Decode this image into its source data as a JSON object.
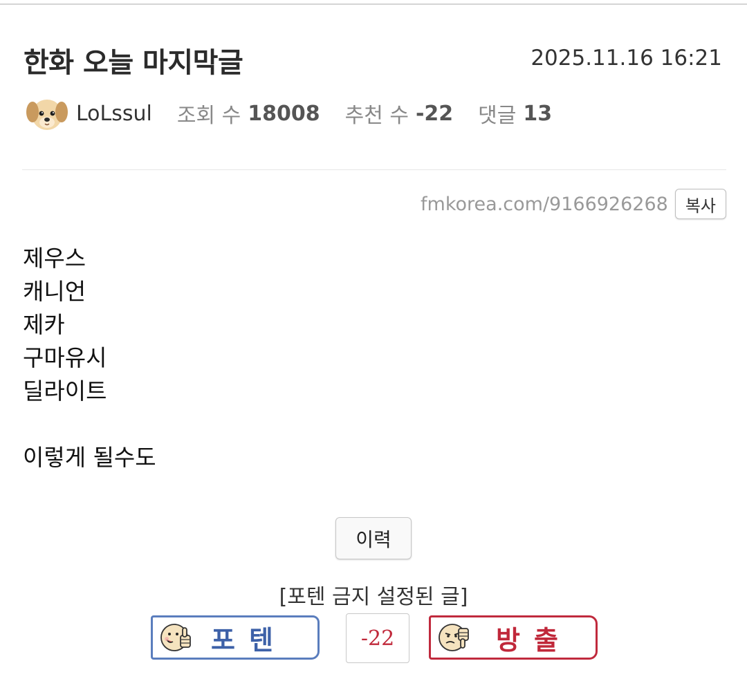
{
  "post": {
    "title": "한화 오늘 마지막글",
    "date": "2025.11.16 16:21",
    "author": "LoLssul",
    "stats": {
      "views_label": "조회 수",
      "views": "18008",
      "recommend_label": "추천 수",
      "recommend": "-22",
      "comments_label": "댓글",
      "comments": "13"
    },
    "url": "fmkorea.com/9166926268",
    "copy_label": "복사",
    "body": {
      "line1": "제우스",
      "line2": "캐니언",
      "line3": "제카",
      "line4": "구마유시",
      "line5": "딜라이트",
      "line6": "이렇게 될수도"
    },
    "history_label": "이력"
  },
  "voting": {
    "notice": "[포텐 금지 설정된 글]",
    "upvote_label": "포텐",
    "downvote_label": "방출",
    "count": "-22"
  },
  "icons": {
    "avatar": "puppy-avatar-icon",
    "upvote": "thumbs-up-face-icon",
    "downvote": "thumbs-down-face-icon"
  },
  "colors": {
    "upvote_accent": "#5a7dbd",
    "downvote_accent": "#c02a3d",
    "vote_count": "#c0283a"
  }
}
